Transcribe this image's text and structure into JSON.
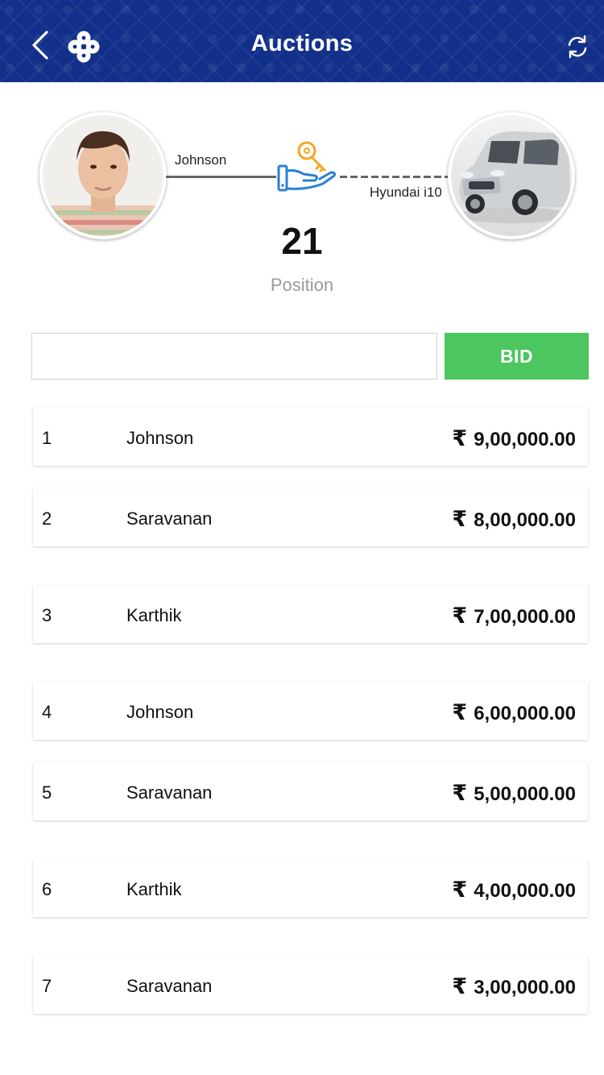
{
  "header": {
    "title": "Auctions",
    "back_icon": "chevron-left-icon",
    "logo_icon": "clover-logo-icon",
    "refresh_icon": "refresh-icon",
    "background_color": "#12308a"
  },
  "summary": {
    "user_name": "Johnson",
    "item_name": "Hyundai i10",
    "position_value": "21",
    "position_label": "Position",
    "icon": "hand-with-key-icon"
  },
  "bid_form": {
    "input_value": "",
    "input_placeholder": "",
    "button_label": "BID",
    "button_color": "#4cc65e"
  },
  "bids": [
    {
      "rank": "1",
      "name": "Johnson",
      "currency": "₹",
      "amount": "9,00,000.00"
    },
    {
      "rank": "2",
      "name": "Saravanan",
      "currency": "₹",
      "amount": "8,00,000.00"
    },
    {
      "rank": "3",
      "name": "Karthik",
      "currency": "₹",
      "amount": "7,00,000.00"
    },
    {
      "rank": "4",
      "name": "Johnson",
      "currency": "₹",
      "amount": "6,00,000.00"
    },
    {
      "rank": "5",
      "name": "Saravanan",
      "currency": "₹",
      "amount": "5,00,000.00"
    },
    {
      "rank": "6",
      "name": "Karthik",
      "currency": "₹",
      "amount": "4,00,000.00"
    },
    {
      "rank": "7",
      "name": "Saravanan",
      "currency": "₹",
      "amount": "3,00,000.00"
    }
  ]
}
